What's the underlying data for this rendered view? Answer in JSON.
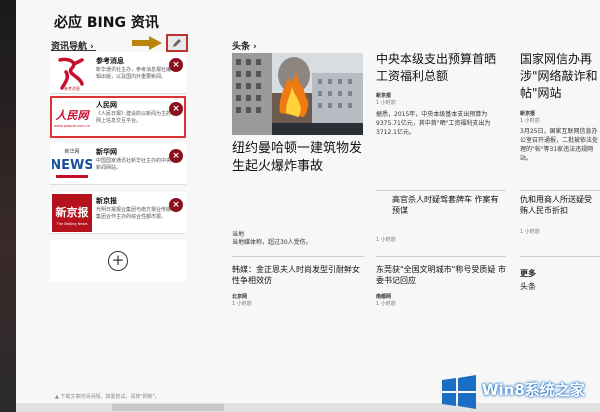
{
  "app": {
    "title": "必应 BING 资讯"
  },
  "nav": {
    "label": "资讯导航",
    "chevron": "›"
  },
  "sources": [
    {
      "name": "参考消息",
      "desc": "新华通讯社主办，参考消息报社编辑出版，以及国内外重要新闻。"
    },
    {
      "name": "人民网",
      "desc": "《人民日报》建设的以新闻为主的网上信息交互平台。"
    },
    {
      "name": "新华网",
      "desc": "中国国家通讯社新华社主办的中央新闻网站。"
    },
    {
      "name": "新京报",
      "desc": "光明日报报业集团与南方报业传媒集团合作主办的综合性都市报。"
    }
  ],
  "logos": {
    "cankao": "参考消息",
    "renmin": "人民网",
    "renmin_url": "www.people.com.cn",
    "xinhua_top": "新华网",
    "xinhua_word": "NEWS",
    "xinjing": "新京报",
    "xinjing_en": "The Beijing News"
  },
  "headlines": {
    "label": "头条",
    "chevron": "›",
    "hero_title": "纽约曼哈顿一建筑物发生起火爆炸事故",
    "hero_snippet": "当地媒体称，超过30人受伤。",
    "hero_snippet_prefix": "当地",
    "col2_top": {
      "title": "中央本级支出预算首晒工资福利总额",
      "source": "新京报",
      "time": "1 小时前",
      "snippet": "据悉，2015年，中央本级基本支出预算为9375.71亿元，其中首\"晒\"工资福利支出为3712.1亿元。"
    },
    "col2_mid": {
      "title": "高官杀人时疑驾套牌车 作案有预谋",
      "time": "1 小时前"
    },
    "col1_bottom": {
      "title": "韩媒：金正恩夫人时尚发型引耐鲜女性争相效仿",
      "source": "北京网",
      "time": "1 小时前"
    },
    "col2_bottom": {
      "title": "东莞获\"全国文明城市\"称号受质疑 市委书记回应",
      "source": "南都网",
      "time": "1 小时前"
    },
    "col3_top": {
      "title": "国家网信办再涉\"网络敲诈和帖\"网站",
      "source": "新京报",
      "time": "1 小时前",
      "snippet": "3月25日，国家互联网信息办公室召开通报，二批被依法处理的\"帖\"等31家违法违规网站。"
    },
    "col3_mid": {
      "title": "仇和用商人所送疑受贿人民币折扣",
      "time": "1 小时前"
    }
  },
  "more": {
    "label": "更多",
    "sub": "头条"
  },
  "footer": {
    "note": "▲ 下载文章时间间隔，如需尝试，请按\"刷新\"。"
  },
  "watermark": {
    "text": "Win8系统之家"
  },
  "colors": {
    "remove": "#8b0f1e",
    "highlight": "#d33333",
    "arrow": "#b8860b",
    "watermark": "#1a6fc4"
  }
}
